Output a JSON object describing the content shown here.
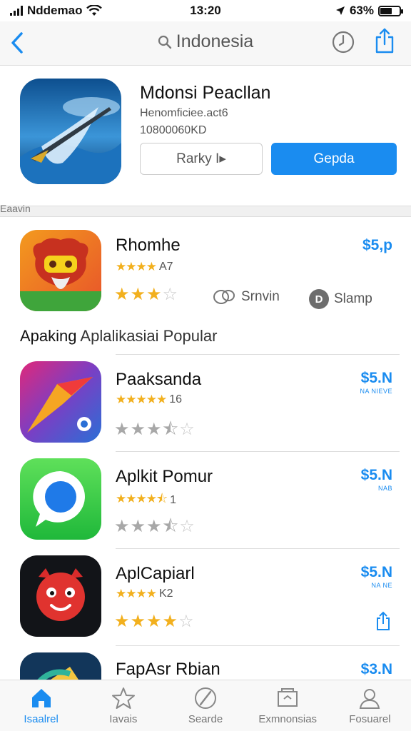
{
  "status": {
    "carrier": "Nddemao",
    "time": "13:20",
    "battery": "63%",
    "battery_level": 0.63
  },
  "nav": {
    "search_title": "Indonesia"
  },
  "featured": {
    "title": "Mdonsi Peacllan",
    "subtitle1": "Henomficiee.act6",
    "subtitle2": "10800060KD",
    "secondary_button": "Rarky I▸",
    "primary_button": "Gepda",
    "accent": "#1a8cf0"
  },
  "section_label": "Eaavin",
  "top_app": {
    "name": "Rhomhe",
    "rating_text": "A7",
    "rating_small": 4,
    "rating_big": 3,
    "price": "$5,p",
    "chip1_label": "Srnvin",
    "chip2_label": "Slamp"
  },
  "popular": {
    "heading_bold": "Apaking",
    "heading_rest": "Aplalikasiai Popular"
  },
  "apps": [
    {
      "name": "Paaksanda",
      "rating_text": "16",
      "rating_small": 5,
      "rating_big": 3.5,
      "price": "$5.N",
      "price_sub": "NA NIEVE"
    },
    {
      "name": "Aplkit Pomur",
      "rating_text": "1",
      "rating_small": 4.5,
      "rating_big": 3.5,
      "price": "$5.N",
      "price_sub": "NAB"
    },
    {
      "name": "AplCapiarl",
      "rating_text": "K2",
      "rating_small": 4,
      "rating_big": 4,
      "price": "$5.N",
      "price_sub": "NA NE"
    },
    {
      "name": "FapAsr Rbian",
      "price": "$3.N"
    }
  ],
  "tabs": [
    {
      "label": "Isaalrel",
      "icon": "home-icon",
      "active": true
    },
    {
      "label": "Iavais",
      "icon": "star-icon",
      "active": false
    },
    {
      "label": "Searde",
      "icon": "search-icon",
      "active": false
    },
    {
      "label": "Exmnonsias",
      "icon": "category-icon",
      "active": false
    },
    {
      "label": "Fosuarel",
      "icon": "account-icon",
      "active": false
    }
  ]
}
